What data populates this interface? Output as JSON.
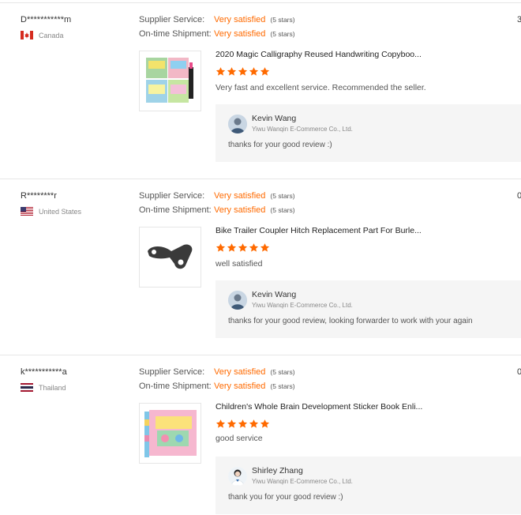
{
  "reviews": [
    {
      "buyer": "D***********m",
      "country": "Canada",
      "supplier_label": "Supplier Service:",
      "supplier_value": "Very satisfied",
      "supplier_count": "(5 stars)",
      "shipment_label": "On-time Shipment:",
      "shipment_value": "Very satisfied",
      "shipment_count": "(5 stars)",
      "cut_text": "3",
      "product_title": "2020 Magic Calligraphy Reused Handwriting Copyboo...",
      "rating": 5,
      "comment": "Very fast and excellent service. Recommended the seller.",
      "reply_name": "Kevin Wang",
      "reply_company": "Yiwu Wanqin E-Commerce Co., Ltd.",
      "reply_text": "thanks for your good review :)"
    },
    {
      "buyer": "R********r",
      "country": "United States",
      "supplier_label": "Supplier Service:",
      "supplier_value": "Very satisfied",
      "supplier_count": "(5 stars)",
      "shipment_label": "On-time Shipment:",
      "shipment_value": "Very satisfied",
      "shipment_count": "(5 stars)",
      "cut_text": "0",
      "product_title": "Bike Trailer Coupler Hitch Replacement Part For Burle...",
      "rating": 5,
      "comment": "well satisfied",
      "reply_name": "Kevin Wang",
      "reply_company": "Yiwu Wanqin E-Commerce Co., Ltd.",
      "reply_text": "thanks for your good review, looking forwarder to work with your again"
    },
    {
      "buyer": "k***********a",
      "country": "Thailand",
      "supplier_label": "Supplier Service:",
      "supplier_value": "Very satisfied",
      "supplier_count": "(5 stars)",
      "shipment_label": "On-time Shipment:",
      "shipment_value": "Very satisfied",
      "shipment_count": "(5 stars)",
      "cut_text": "0",
      "product_title": "Children's Whole Brain Development Sticker Book Enli...",
      "rating": 5,
      "comment": "good service",
      "reply_name": "Shirley Zhang",
      "reply_company": "Yiwu Wanqin E-Commerce Co., Ltd.",
      "reply_text": "thank you for your good review :)"
    }
  ],
  "colors": {
    "accent": "#ff6a00",
    "star": "#ff6a00",
    "reply_bg": "#f5f5f5",
    "divider": "#e6e6e6"
  },
  "icons": {
    "star": "star-icon",
    "flag_canada": "canada-flag-icon",
    "flag_us": "us-flag-icon",
    "flag_thailand": "thailand-flag-icon"
  }
}
